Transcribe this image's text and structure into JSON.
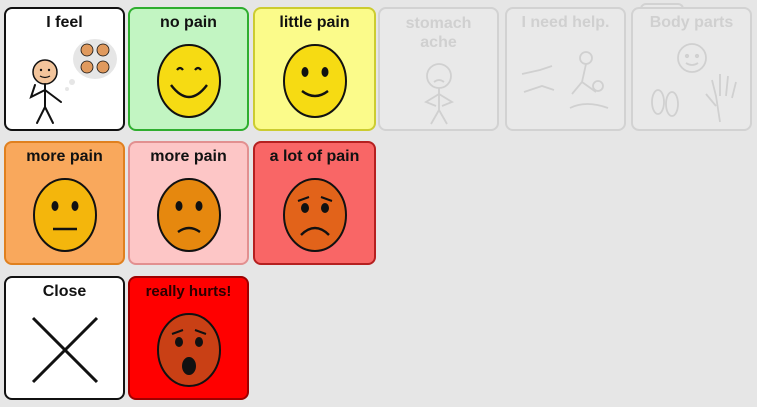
{
  "tiles": {
    "i_feel": {
      "label": "I feel",
      "bg": "#ffffff",
      "border": "#111111"
    },
    "no_pain": {
      "label": "no pain",
      "bg": "#c2f5c2",
      "border": "#2fae2f"
    },
    "little_pain": {
      "label": "little pain",
      "bg": "#fbfb8a",
      "border": "#cccc30"
    },
    "stomach_ache": {
      "label": "stomach ache",
      "state": "disabled"
    },
    "need_help": {
      "label": "I need help.",
      "state": "disabled"
    },
    "body_parts": {
      "label": "Body parts",
      "state": "disabled"
    },
    "more_pain_1": {
      "label": "more pain",
      "bg": "#f9a85c",
      "border": "#e0801e"
    },
    "more_pain_2": {
      "label": "more pain",
      "bg": "#fdc6c6",
      "border": "#e29090"
    },
    "a_lot_of_pain": {
      "label": "a lot of pain",
      "bg": "#f96666",
      "border": "#b52020"
    },
    "close": {
      "label": "Close",
      "bg": "#ffffff",
      "border": "#111111"
    },
    "really_hurts": {
      "label": "really hurts!",
      "bg": "#ff0000",
      "border": "#9e0000"
    }
  },
  "colors": {
    "board_background": "#e6e6e6",
    "face_yellow": "#f6db13",
    "face_light_orange": "#f4b60c",
    "face_orange": "#e6880e",
    "face_dark_orange": "#e2631a",
    "face_red_brown": "#c94015"
  },
  "icons": {
    "i_feel": "person-thinking-of-faces-icon",
    "no_pain": "big-smile-face-icon",
    "little_pain": "smile-face-icon",
    "stomach_ache": "stomach-ache-figure-icon",
    "need_help": "help-figures-icon",
    "body_parts": "body-parts-icon",
    "more_pain_1": "neutral-face-icon",
    "more_pain_2": "slight-frown-face-icon",
    "a_lot_of_pain": "sad-face-icon",
    "close": "close-x-icon",
    "really_hurts": "shocked-face-icon"
  }
}
